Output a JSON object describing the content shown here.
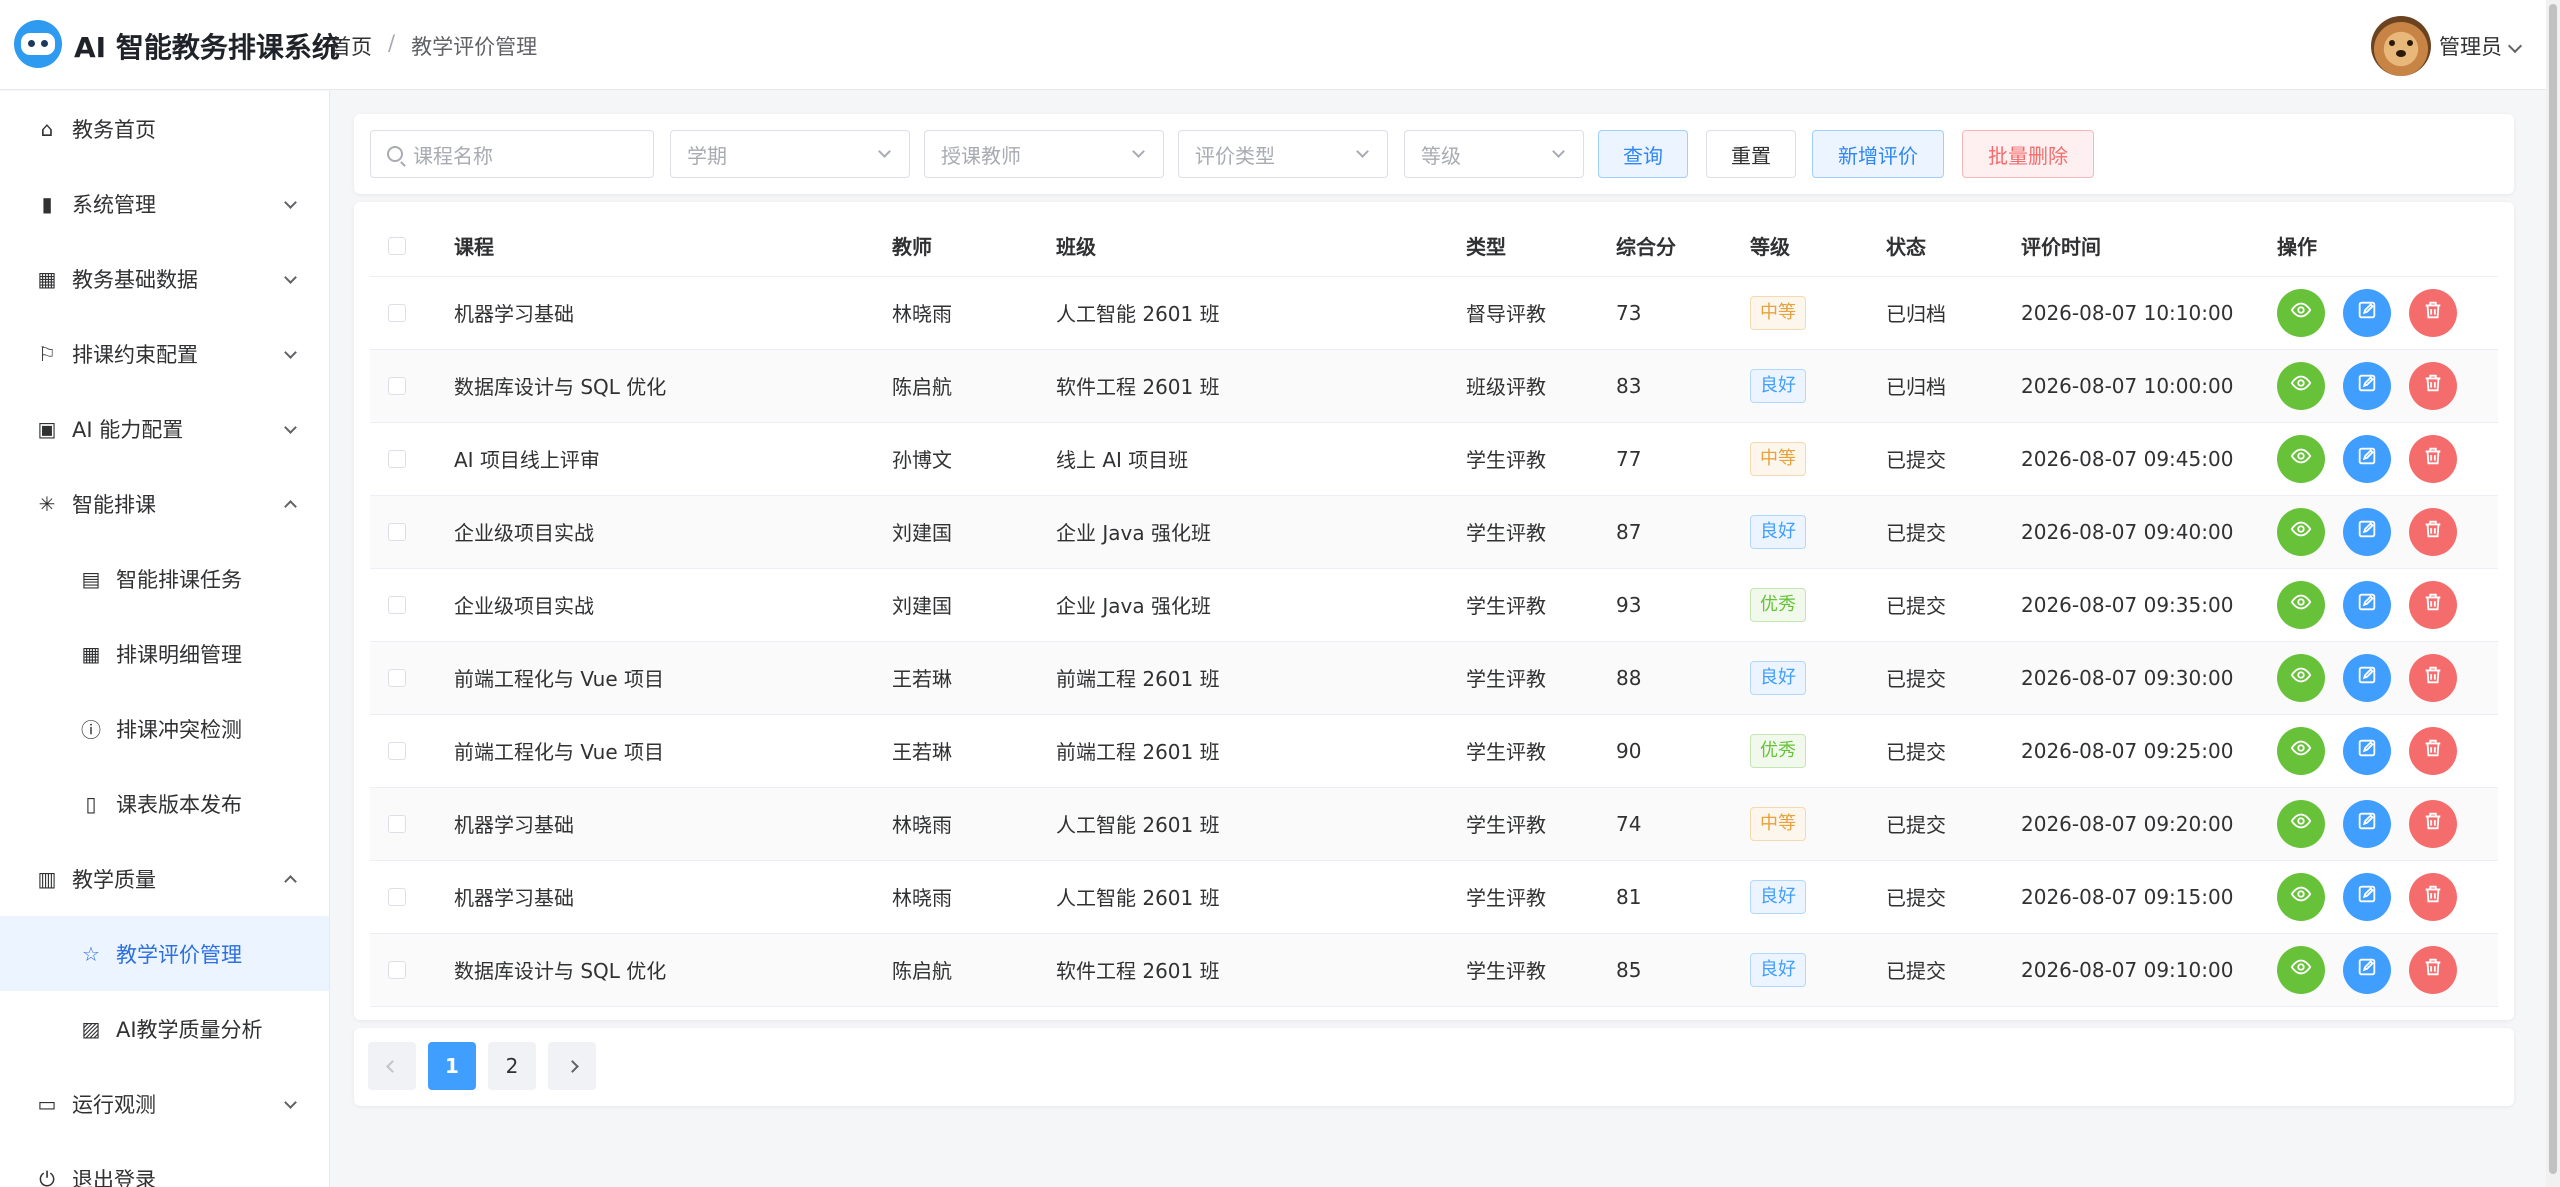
{
  "header": {
    "app_title": "AI 智能教务排课系统",
    "breadcrumb": [
      "首页",
      "教学评价管理"
    ],
    "user_name": "管理员"
  },
  "sidebar": {
    "items": [
      {
        "label": "教务首页",
        "icon": "home-icon",
        "level": 1,
        "expand": "none"
      },
      {
        "label": "系统管理",
        "icon": "book-icon",
        "level": 1,
        "expand": "collapsed"
      },
      {
        "label": "教务基础数据",
        "icon": "grid-icon",
        "level": 1,
        "expand": "collapsed"
      },
      {
        "label": "排课约束配置",
        "icon": "signpost-icon",
        "level": 1,
        "expand": "collapsed"
      },
      {
        "label": "AI 能力配置",
        "icon": "chip-icon",
        "level": 1,
        "expand": "collapsed"
      },
      {
        "label": "智能排课",
        "icon": "sparkle-icon",
        "level": 1,
        "expand": "expanded"
      },
      {
        "label": "智能排课任务",
        "icon": "clipboard-icon",
        "level": 2,
        "expand": "none"
      },
      {
        "label": "排课明细管理",
        "icon": "calendar-icon",
        "level": 2,
        "expand": "none"
      },
      {
        "label": "排课冲突检测",
        "icon": "warning-circle-icon",
        "level": 2,
        "expand": "none"
      },
      {
        "label": "课表版本发布",
        "icon": "document-icon",
        "level": 2,
        "expand": "none"
      },
      {
        "label": "教学质量",
        "icon": "bar-chart-icon",
        "level": 1,
        "expand": "expanded"
      },
      {
        "label": "教学评价管理",
        "icon": "star-icon",
        "level": 2,
        "expand": "none",
        "active": true
      },
      {
        "label": "AI教学质量分析",
        "icon": "trend-chart-icon",
        "level": 2,
        "expand": "none"
      },
      {
        "label": "运行观测",
        "icon": "monitor-icon",
        "level": 1,
        "expand": "collapsed"
      },
      {
        "label": "退出登录",
        "icon": "power-icon",
        "level": 1,
        "expand": "none"
      }
    ]
  },
  "filters": {
    "course_placeholder": "课程名称",
    "term_placeholder": "学期",
    "teacher_placeholder": "授课教师",
    "type_placeholder": "评价类型",
    "grade_placeholder": "等级",
    "query_label": "查询",
    "reset_label": "重置",
    "add_label": "新增评价",
    "batch_delete_label": "批量删除"
  },
  "table": {
    "columns": [
      "课程",
      "教师",
      "班级",
      "类型",
      "综合分",
      "等级",
      "状态",
      "评价时间",
      "操作"
    ],
    "rows": [
      {
        "course": "机器学习基础",
        "teacher": "林晓雨",
        "class": "人工智能 2601 班",
        "type": "督导评教",
        "score": "73",
        "grade": "中等",
        "status": "已归档",
        "time": "2026-08-07 10:10:00"
      },
      {
        "course": "数据库设计与 SQL 优化",
        "teacher": "陈启航",
        "class": "软件工程 2601 班",
        "type": "班级评教",
        "score": "83",
        "grade": "良好",
        "status": "已归档",
        "time": "2026-08-07 10:00:00"
      },
      {
        "course": "AI 项目线上评审",
        "teacher": "孙博文",
        "class": "线上 AI 项目班",
        "type": "学生评教",
        "score": "77",
        "grade": "中等",
        "status": "已提交",
        "time": "2026-08-07 09:45:00"
      },
      {
        "course": "企业级项目实战",
        "teacher": "刘建国",
        "class": "企业 Java 强化班",
        "type": "学生评教",
        "score": "87",
        "grade": "良好",
        "status": "已提交",
        "time": "2026-08-07 09:40:00"
      },
      {
        "course": "企业级项目实战",
        "teacher": "刘建国",
        "class": "企业 Java 强化班",
        "type": "学生评教",
        "score": "93",
        "grade": "优秀",
        "status": "已提交",
        "time": "2026-08-07 09:35:00"
      },
      {
        "course": "前端工程化与 Vue 项目",
        "teacher": "王若琳",
        "class": "前端工程 2601 班",
        "type": "学生评教",
        "score": "88",
        "grade": "良好",
        "status": "已提交",
        "time": "2026-08-07 09:30:00"
      },
      {
        "course": "前端工程化与 Vue 项目",
        "teacher": "王若琳",
        "class": "前端工程 2601 班",
        "type": "学生评教",
        "score": "90",
        "grade": "优秀",
        "status": "已提交",
        "time": "2026-08-07 09:25:00"
      },
      {
        "course": "机器学习基础",
        "teacher": "林晓雨",
        "class": "人工智能 2601 班",
        "type": "学生评教",
        "score": "74",
        "grade": "中等",
        "status": "已提交",
        "time": "2026-08-07 09:20:00"
      },
      {
        "course": "机器学习基础",
        "teacher": "林晓雨",
        "class": "人工智能 2601 班",
        "type": "学生评教",
        "score": "81",
        "grade": "良好",
        "status": "已提交",
        "time": "2026-08-07 09:15:00"
      },
      {
        "course": "数据库设计与 SQL 优化",
        "teacher": "陈启航",
        "class": "软件工程 2601 班",
        "type": "学生评教",
        "score": "85",
        "grade": "良好",
        "status": "已提交",
        "time": "2026-08-07 09:10:00"
      }
    ]
  },
  "pagination": {
    "pages": [
      "1",
      "2"
    ],
    "current": "1"
  },
  "colors": {
    "primary": "#409eff",
    "success": "#67c23a",
    "danger": "#f56c6c",
    "warning": "#e6a23c"
  }
}
